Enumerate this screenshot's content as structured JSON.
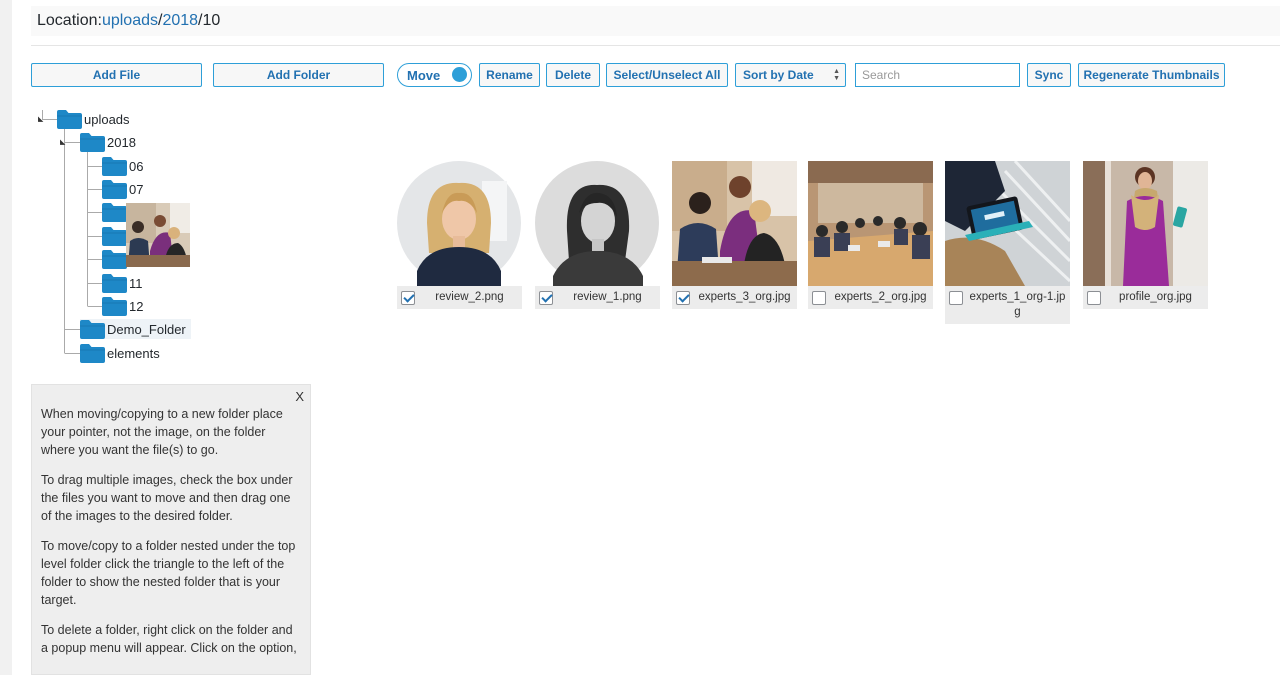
{
  "location": {
    "label": "Location: ",
    "segments": [
      "uploads",
      "2018"
    ],
    "current": "10",
    "separator": "/"
  },
  "toolbar": {
    "add_file": "Add File",
    "add_folder": "Add Folder",
    "move_toggle": "Move",
    "rename": "Rename",
    "delete": "Delete",
    "select_unselect_all": "Select/Unselect All",
    "sort_selected": "Sort by Date",
    "search_placeholder": "Search",
    "sync": "Sync",
    "regenerate": "Regenerate Thumbnails"
  },
  "tree": {
    "root": "uploads",
    "year": "2018",
    "months": [
      "06",
      "07",
      "11",
      "12"
    ],
    "demo_folder": "Demo_Folder",
    "elements": "elements"
  },
  "help": {
    "close": "X",
    "paragraphs": [
      "When moving/copying to a new folder place your pointer, not the image, on the folder where you want the file(s) to go.",
      "To drag multiple images, check the box under the files you want to move and then drag one of the images to the desired folder.",
      "To move/copy to a folder nested under the top level folder click the triangle to the left of the folder to show the nested folder that is your target.",
      "To delete a folder, right click on the folder and a popup menu will appear. Click on the option,"
    ]
  },
  "files": [
    {
      "name": "review_2.png",
      "checked": true
    },
    {
      "name": "review_1.png",
      "checked": true
    },
    {
      "name": "experts_3_org.jpg",
      "checked": true
    },
    {
      "name": "experts_2_org.jpg",
      "checked": false
    },
    {
      "name": "experts_1_org-1.jpg",
      "checked": false
    },
    {
      "name": "profile_org.jpg",
      "checked": false
    }
  ],
  "colors": {
    "accent": "#2e9fd8",
    "link": "#2271b1",
    "folder": "#1e88c7"
  }
}
